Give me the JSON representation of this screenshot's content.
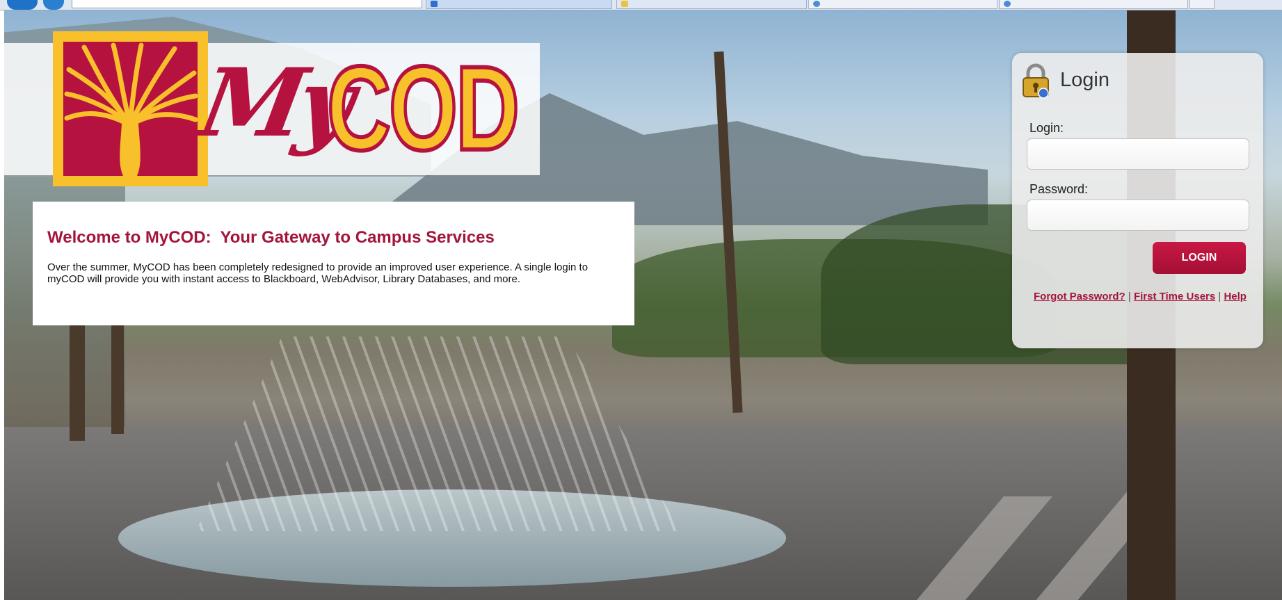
{
  "brand": {
    "logo_my": "My",
    "logo_cod": "COD",
    "primary_color": "#b5123f",
    "accent_color": "#f8c12c"
  },
  "welcome": {
    "heading": "Welcome to MyCOD:  Your Gateway to Campus Services",
    "body": "Over the summer, MyCOD has been completely redesigned to provide an improved user experience.  A single login to myCOD will provide you with instant access to Blackboard, WebAdvisor, Library Databases, and more."
  },
  "login": {
    "title": "Login",
    "icon": "padlock-icon",
    "login_label": "Login:",
    "login_value": "",
    "password_label": "Password:",
    "password_value": "",
    "button_label": "LOGIN",
    "links": {
      "forgot_password": "Forgot Password?",
      "first_time_users": "First Time Users",
      "help": "Help",
      "separator": "|"
    }
  }
}
